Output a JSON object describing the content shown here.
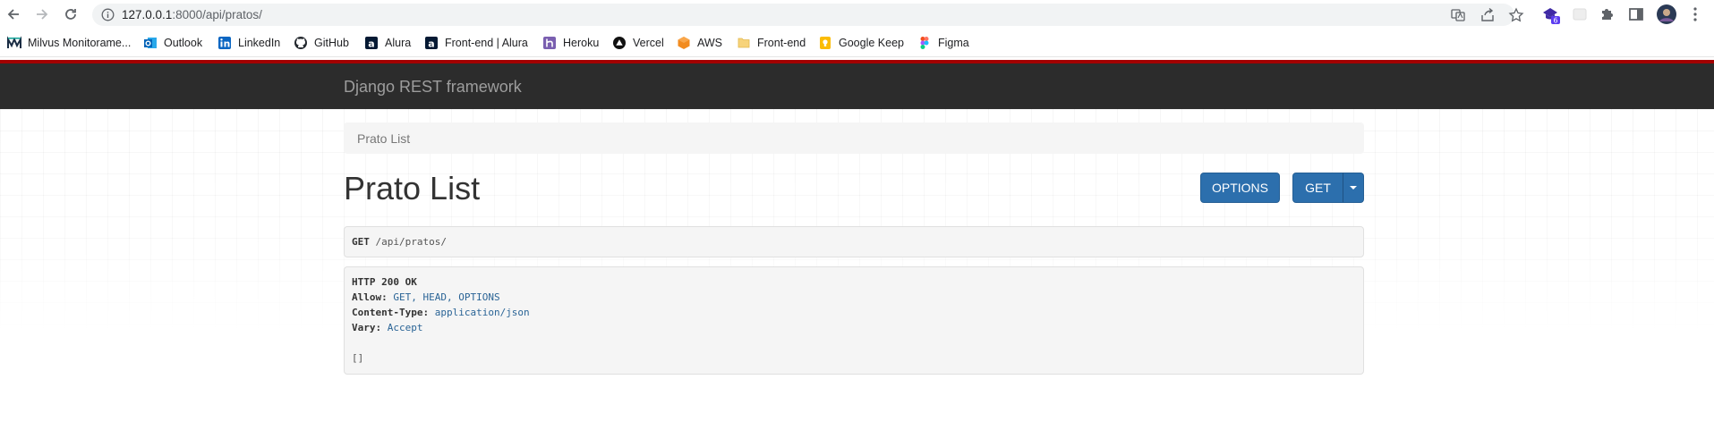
{
  "browser": {
    "url_host": "127.0.0.1",
    "url_port_path": ":8000/api/pratos/",
    "extension_badge": "6",
    "bookmarks": [
      {
        "label": "Milvus Monitorame...",
        "icon": "milvus-icon"
      },
      {
        "label": "Outlook",
        "icon": "outlook-icon"
      },
      {
        "label": "LinkedIn",
        "icon": "linkedin-icon"
      },
      {
        "label": "GitHub",
        "icon": "github-icon"
      },
      {
        "label": "Alura",
        "icon": "alura-icon"
      },
      {
        "label": "Front-end | Alura",
        "icon": "alura-icon"
      },
      {
        "label": "Heroku",
        "icon": "heroku-icon"
      },
      {
        "label": "Vercel",
        "icon": "vercel-icon"
      },
      {
        "label": "AWS",
        "icon": "aws-icon"
      },
      {
        "label": "Front-end",
        "icon": "folder-icon"
      },
      {
        "label": "Google Keep",
        "icon": "google-keep-icon"
      },
      {
        "label": "Figma",
        "icon": "figma-icon"
      }
    ]
  },
  "drf": {
    "brand": "Django REST framework",
    "breadcrumb": "Prato List",
    "title": "Prato List",
    "options_button": "OPTIONS",
    "get_button": "GET",
    "request": {
      "method": "GET",
      "path": "/api/pratos/"
    },
    "response": {
      "status": "HTTP 200 OK",
      "allow_key": "Allow:",
      "allow_value": "GET, HEAD, OPTIONS",
      "content_type_key": "Content-Type:",
      "content_type_value": "application/json",
      "vary_key": "Vary:",
      "vary_value": "Accept",
      "body": "[]"
    }
  },
  "colors": {
    "drf_navbar": "#2c2c2c",
    "drf_red_bar": "#a30000",
    "button_primary": "#2c6fad",
    "header_link": "#2a6496"
  }
}
